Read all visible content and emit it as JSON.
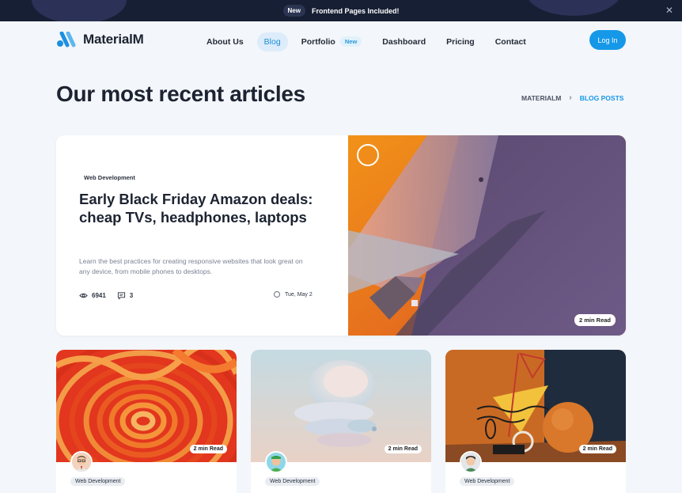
{
  "announcement": {
    "badge": "New",
    "message": "Frontend Pages Included!"
  },
  "header": {
    "logo_text": "MaterialM",
    "nav": [
      {
        "label": "About Us",
        "active": false
      },
      {
        "label": "Blog",
        "active": true
      },
      {
        "label": "Portfolio",
        "active": false,
        "badge": "New"
      },
      {
        "label": "Dashboard",
        "active": false
      },
      {
        "label": "Pricing",
        "active": false
      },
      {
        "label": "Contact",
        "active": false
      }
    ],
    "login_label": "Log In"
  },
  "page": {
    "title": "Our most recent articles",
    "breadcrumb": {
      "home": "MATERIALM",
      "separator": "›",
      "current": "BLOG POSTS"
    }
  },
  "featured": {
    "category": "Web Development",
    "title": "Early Black Friday Amazon deals: cheap TVs, headphones, laptops",
    "description": "Learn the best practices for creating responsive websites that look great on any device, from mobile phones to desktops.",
    "views": "6941",
    "comments": "3",
    "date": "Tue, May 2",
    "read_time": "2 min Read"
  },
  "cards": [
    {
      "category": "Web Development",
      "read_time": "2 min Read"
    },
    {
      "category": "Web Development",
      "read_time": "2 min Read"
    },
    {
      "category": "Web Development",
      "read_time": "2 min Read"
    }
  ],
  "colors": {
    "accent": "#1598e8",
    "topbar": "#171f34",
    "background": "#f3f6fa"
  }
}
